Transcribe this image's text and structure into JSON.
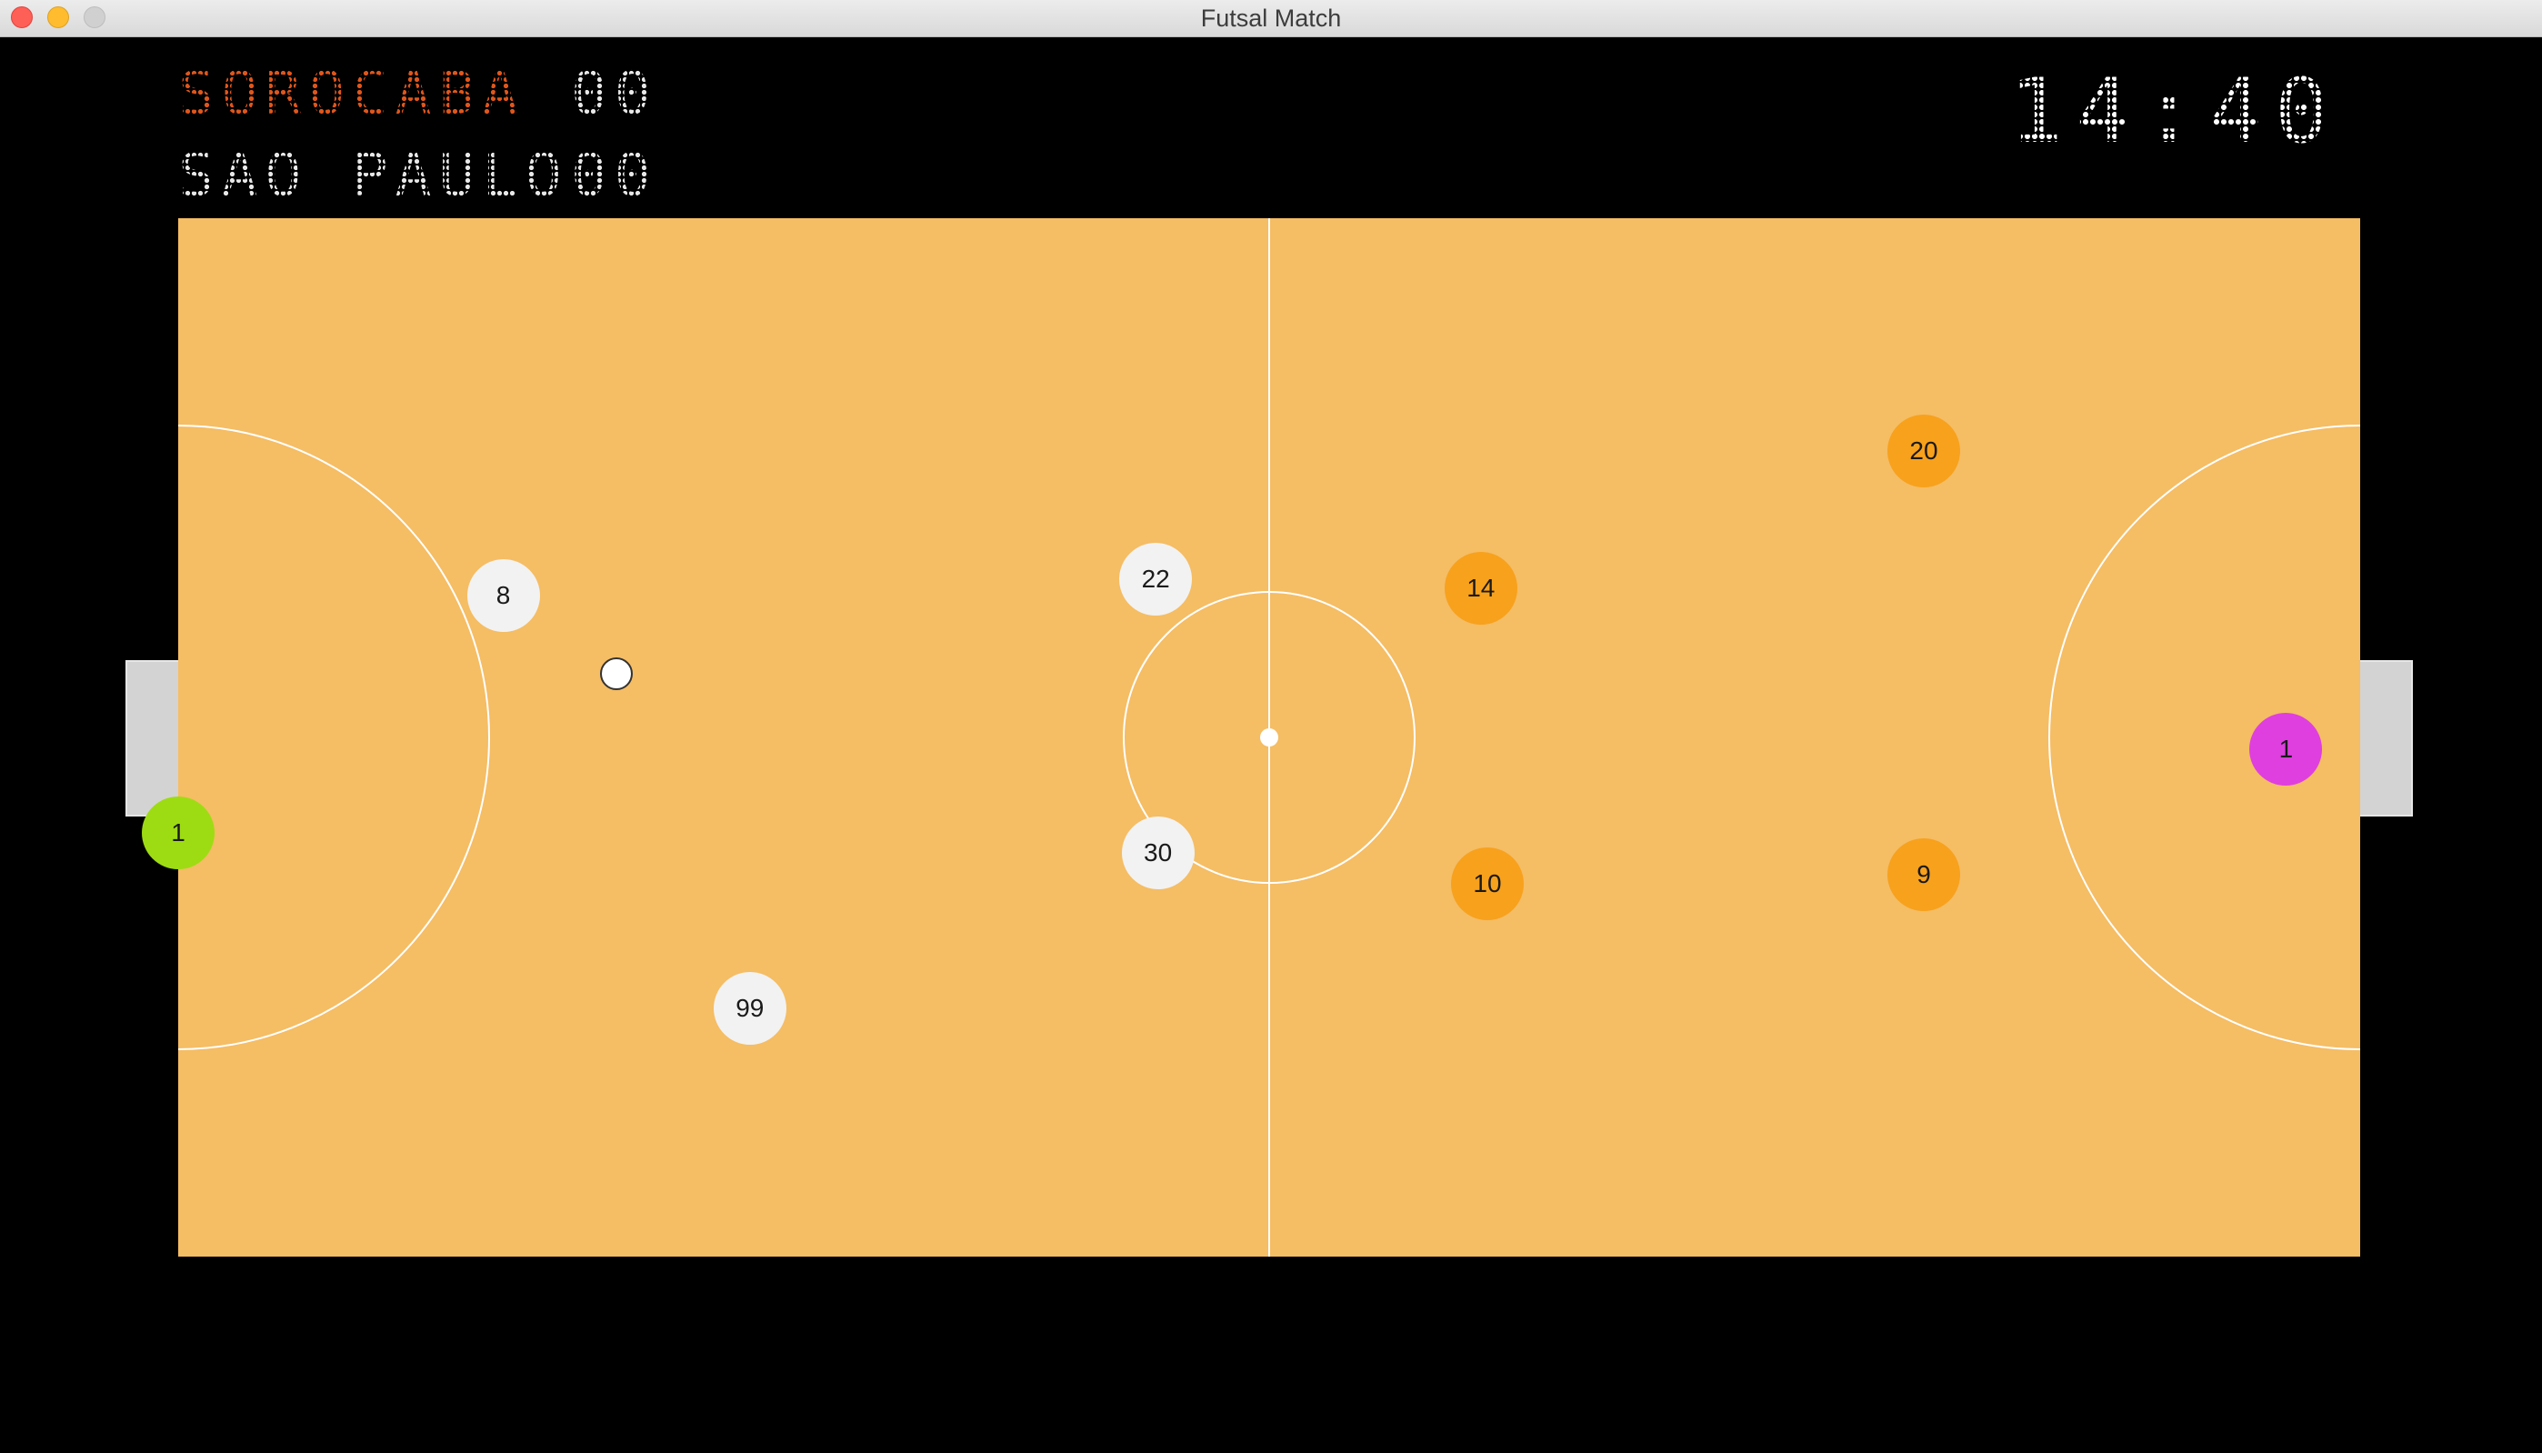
{
  "window": {
    "title": "Futsal Match"
  },
  "scoreboard": {
    "home_team": "SOROCABA",
    "home_score": "00",
    "away_team": "SAO PAULO",
    "away_score": "00",
    "clock": "14:40",
    "home_color": "#e0561b",
    "away_color": "#e8e8e8"
  },
  "court": {
    "surface_color": "#f5bd64",
    "line_color": "#ffffff"
  },
  "players": [
    {
      "number": "1",
      "team": "white-goalkeeper",
      "color": "#9ddc12",
      "fx": 0.0,
      "fy": 0.592
    },
    {
      "number": "8",
      "team": "white",
      "color": "#f2f2f2",
      "fx": 0.149,
      "fy": 0.363
    },
    {
      "number": "99",
      "team": "white",
      "color": "#f2f2f2",
      "fx": 0.262,
      "fy": 0.761
    },
    {
      "number": "22",
      "team": "white",
      "color": "#f2f2f2",
      "fx": 0.448,
      "fy": 0.348
    },
    {
      "number": "30",
      "team": "white",
      "color": "#f2f2f2",
      "fx": 0.449,
      "fy": 0.611
    },
    {
      "number": "14",
      "team": "orange",
      "color": "#f7a11d",
      "fx": 0.597,
      "fy": 0.356
    },
    {
      "number": "10",
      "team": "orange",
      "color": "#f7a11d",
      "fx": 0.6,
      "fy": 0.641
    },
    {
      "number": "20",
      "team": "orange",
      "color": "#f7a11d",
      "fx": 0.8,
      "fy": 0.224
    },
    {
      "number": "9",
      "team": "orange",
      "color": "#f7a11d",
      "fx": 0.8,
      "fy": 0.632
    },
    {
      "number": "1",
      "team": "orange-goalkeeper",
      "color": "#df3fdf",
      "fx": 0.966,
      "fy": 0.511
    }
  ],
  "ball": {
    "fx": 0.201,
    "fy": 0.439,
    "color": "#ffffff"
  }
}
